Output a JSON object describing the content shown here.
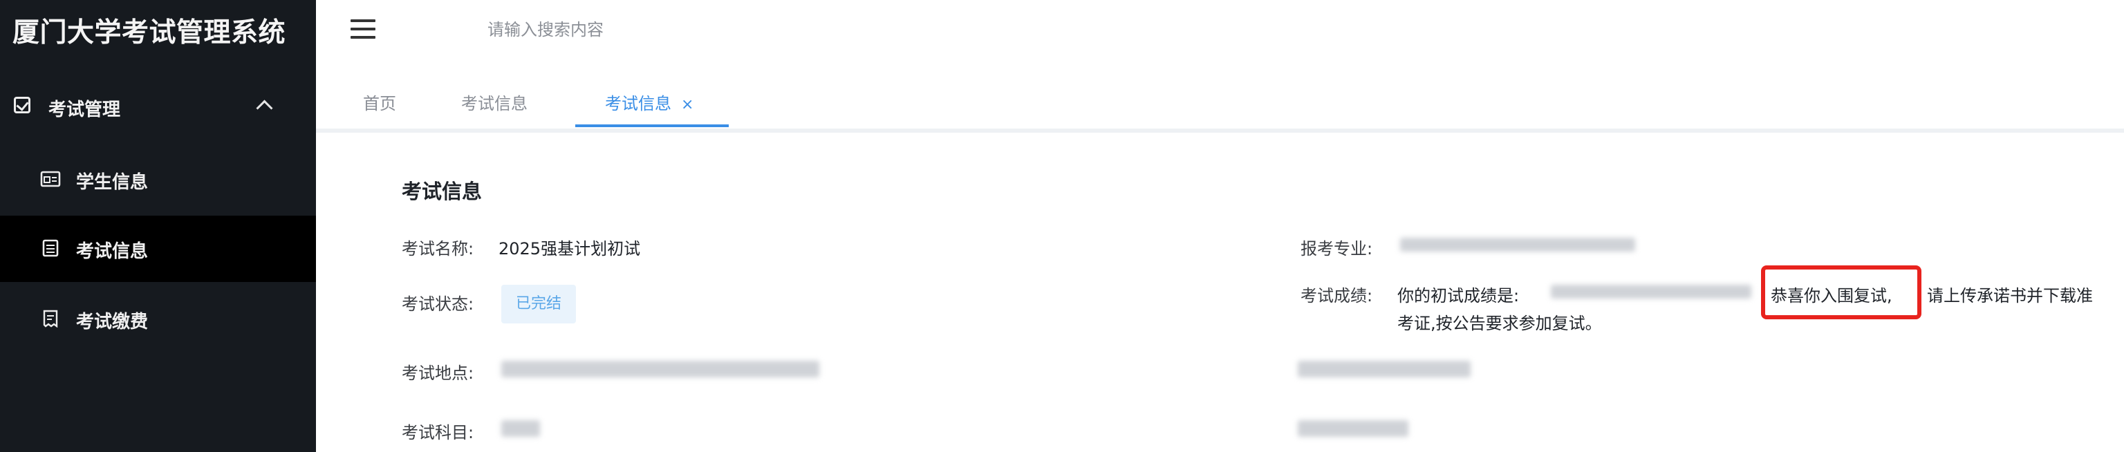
{
  "app": {
    "title": "厦门大学考试管理系统"
  },
  "sidebar": {
    "group_label": "考试管理",
    "items": [
      {
        "label": "学生信息",
        "icon": "id-card-icon"
      },
      {
        "label": "考试信息",
        "icon": "document-list-icon",
        "active": true
      },
      {
        "label": "考试缴费",
        "icon": "receipt-icon"
      }
    ]
  },
  "header": {
    "search_placeholder": "请输入搜索内容"
  },
  "tabs": [
    {
      "label": "首页"
    },
    {
      "label": "考试信息"
    },
    {
      "label": "考试信息",
      "active": true,
      "close": "×"
    }
  ],
  "exam": {
    "section_title": "考试信息",
    "name_label": "考试名称:",
    "name_value": "2025强基计划初试",
    "status_label": "考试状态:",
    "status_value": "已完结",
    "location_label": "考试地点:",
    "subject_label": "考试科目:",
    "major_label": "报考专业:",
    "score_label": "考试成绩:",
    "score_prefix": "你的初试成绩是:",
    "score_congrats": "恭喜你入围复试,",
    "score_suffix_1": "请上传承诺书并下载准",
    "score_suffix_2": "考证,按公告要求参加复试。"
  },
  "colors": {
    "sidebar_bg": "#161a1f",
    "active_item_bg": "#000000",
    "accent": "#3a8ee6",
    "highlight_border": "#e8231e"
  }
}
